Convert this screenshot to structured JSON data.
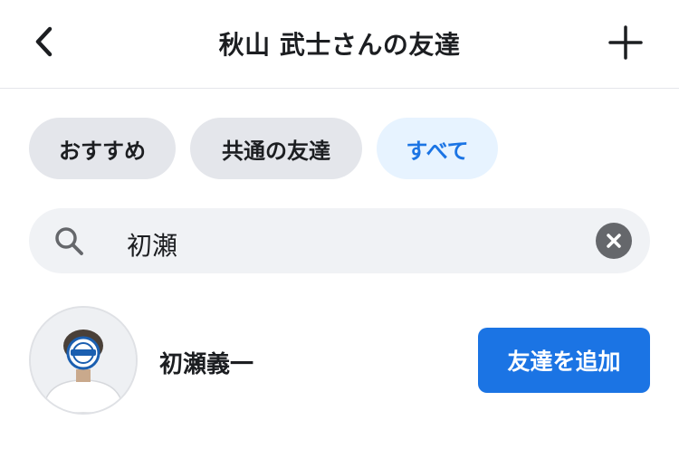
{
  "header": {
    "title": "秋山 武士さんの友達",
    "back_icon": "chevron-left-icon",
    "add_icon": "plus-icon"
  },
  "tabs": [
    {
      "label": "おすすめ",
      "active": false
    },
    {
      "label": "共通の友達",
      "active": false
    },
    {
      "label": "すべて",
      "active": true
    }
  ],
  "search": {
    "value": "初瀬",
    "icon": "search-icon",
    "clear_icon": "clear-icon"
  },
  "results": [
    {
      "name": "初瀬義一",
      "action_label": "友達を追加"
    }
  ],
  "colors": {
    "accent": "#1b74e4",
    "active_tab_bg": "#e7f3ff",
    "chip_bg": "#e4e6eb",
    "search_bg": "#f0f2f5"
  }
}
